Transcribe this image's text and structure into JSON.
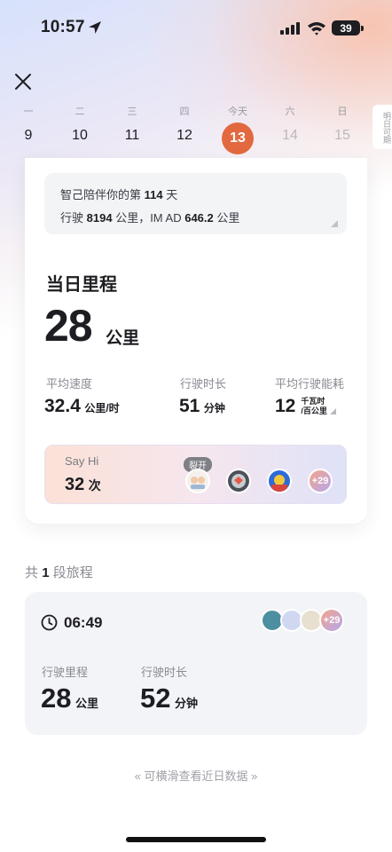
{
  "status_bar": {
    "time": "10:57",
    "battery": "39"
  },
  "week": {
    "days": [
      {
        "label": "一",
        "num": "9",
        "state": "past"
      },
      {
        "label": "二",
        "num": "10",
        "state": "past"
      },
      {
        "label": "三",
        "num": "11",
        "state": "past"
      },
      {
        "label": "四",
        "num": "12",
        "state": "past"
      },
      {
        "label": "今天",
        "num": "13",
        "state": "today"
      },
      {
        "label": "六",
        "num": "14",
        "state": "future"
      },
      {
        "label": "日",
        "num": "15",
        "state": "future"
      }
    ],
    "tomorrow_tab": "明日可期"
  },
  "companion": {
    "line1_prefix": "智己陪伴你的第",
    "days": "114",
    "line1_suffix": "天",
    "line2_prefix": "行驶",
    "total_km": "8194",
    "line2_mid": "公里，IM AD",
    "imad_km": "646.2",
    "line2_suffix": "公里"
  },
  "day_mileage": {
    "title": "当日里程",
    "value": "28",
    "unit": "公里"
  },
  "stats": {
    "avg_speed": {
      "label": "平均速度",
      "value": "32.4",
      "unit": "公里/时"
    },
    "duration": {
      "label": "行驶时长",
      "value": "51",
      "unit": "分钟"
    },
    "energy": {
      "label": "平均行驶能耗",
      "value": "12",
      "unit_top": "千瓦时",
      "unit_bottom": "/百公里"
    }
  },
  "say_hi": {
    "title": "Say Hi",
    "count": "32",
    "count_unit": "次",
    "tag": "裂开",
    "more": "+29"
  },
  "trips": {
    "prefix": "共",
    "count": "1",
    "suffix": "段旅程",
    "items": [
      {
        "time": "06:49",
        "more": "+29",
        "mileage_label": "行驶里程",
        "mileage_value": "28",
        "mileage_unit": "公里",
        "duration_label": "行驶时长",
        "duration_value": "52",
        "duration_unit": "分钟"
      }
    ]
  },
  "hint": "可横滑查看近日数据",
  "colors": {
    "today": "#e2693f",
    "accent_gradient_start": "#f2a48a",
    "accent_gradient_end": "#b7a6ef"
  }
}
